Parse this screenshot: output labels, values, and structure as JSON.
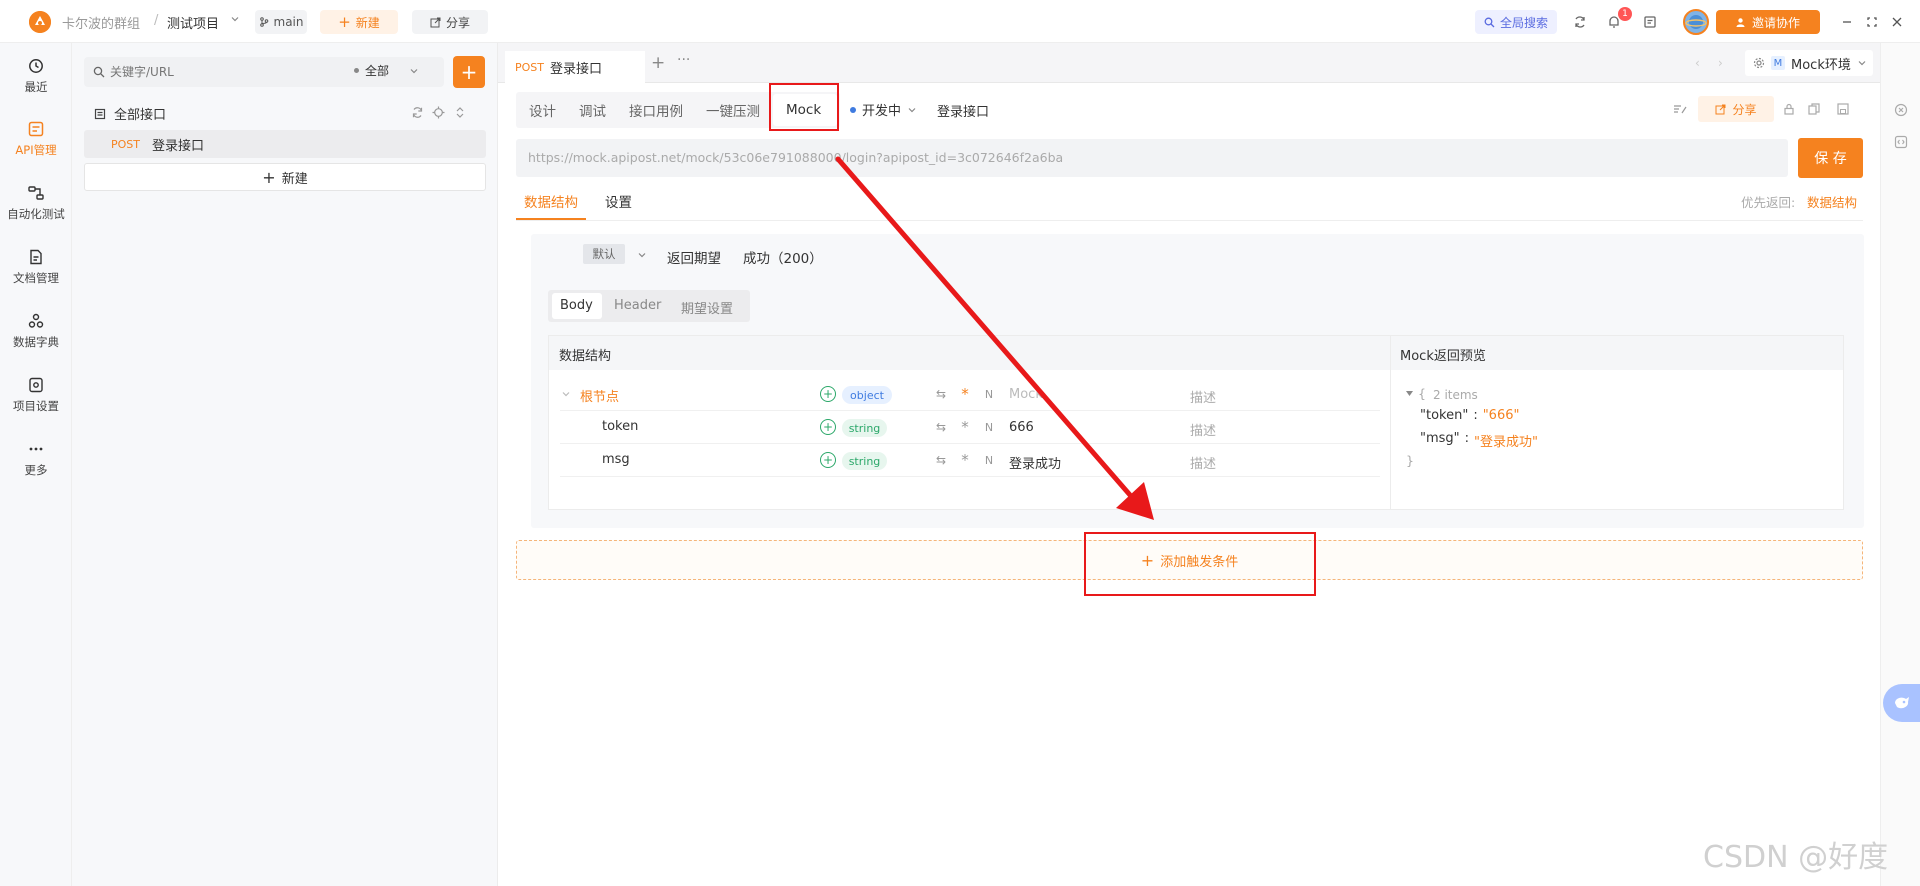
{
  "topbar": {
    "team": "卡尔波的群组",
    "separator": "/",
    "project": "测试项目",
    "branch": "main",
    "new_label": "新建",
    "share_label": "分享",
    "global_search": "全局搜索",
    "notification_count": "1",
    "invite_label": "邀请协作"
  },
  "leftnav": {
    "items": [
      {
        "label": "最近",
        "icon": "clock-icon"
      },
      {
        "label": "API管理",
        "icon": "api-icon"
      },
      {
        "label": "自动化测试",
        "icon": "flow-icon"
      },
      {
        "label": "文档管理",
        "icon": "doc-icon"
      },
      {
        "label": "数据字典",
        "icon": "dict-icon"
      },
      {
        "label": "项目设置",
        "icon": "settings-icon"
      },
      {
        "label": "更多",
        "icon": "more-icon"
      }
    ]
  },
  "tree": {
    "search_placeholder": "关键字/URL",
    "filter_label": "全部",
    "root_label": "全部接口",
    "item_method": "POST",
    "item_label": "登录接口",
    "new_label": "新建"
  },
  "doc_tab": {
    "method": "POST",
    "title": "登录接口",
    "env_badge": "M",
    "env_label": "Mock环境"
  },
  "subtabs": {
    "items": [
      "设计",
      "调试",
      "接口用例",
      "一键压测",
      "Mock"
    ],
    "active": "Mock",
    "status": "开发中",
    "api_name": "登录接口",
    "share_label": "分享"
  },
  "url_bar": {
    "url": "https://mock.apipost.net/mock/53c06e791088000/login?apipost_id=3c072646f2a6ba",
    "save_label": "保 存"
  },
  "mock_tabs": {
    "items": [
      "数据结构",
      "设置"
    ],
    "active": "数据结构",
    "priority_label": "优先返回:",
    "priority_value": "数据结构"
  },
  "expectation": {
    "default_tag": "默认",
    "label": "返回期望",
    "status": "成功（200）"
  },
  "inner_tabs": [
    "Body",
    "Header",
    "期望设置"
  ],
  "table": {
    "header_left": "数据结构",
    "header_right": "Mock返回预览",
    "rows": [
      {
        "name": "根节点",
        "type": "object",
        "mock": "Mock",
        "desc": "描述"
      },
      {
        "name": "token",
        "type": "string",
        "mock": "666",
        "desc": "描述"
      },
      {
        "name": "msg",
        "type": "string",
        "mock": "登录成功",
        "desc": "描述"
      }
    ],
    "preview": {
      "open": "{",
      "count": "2 items",
      "line1_key": "\"token\"",
      "line1_val": "\"666\"",
      "line2_key": "\"msg\"",
      "line2_val": "\"登录成功\"",
      "colon": ":",
      "close": "}"
    }
  },
  "add_condition_label": "添加触发条件",
  "watermark": "CSDN @好度",
  "colors": {
    "accent": "#f5821f",
    "annotation": "#e8191a",
    "string_green": "#2ca86a",
    "object_blue": "#3f7be0"
  }
}
